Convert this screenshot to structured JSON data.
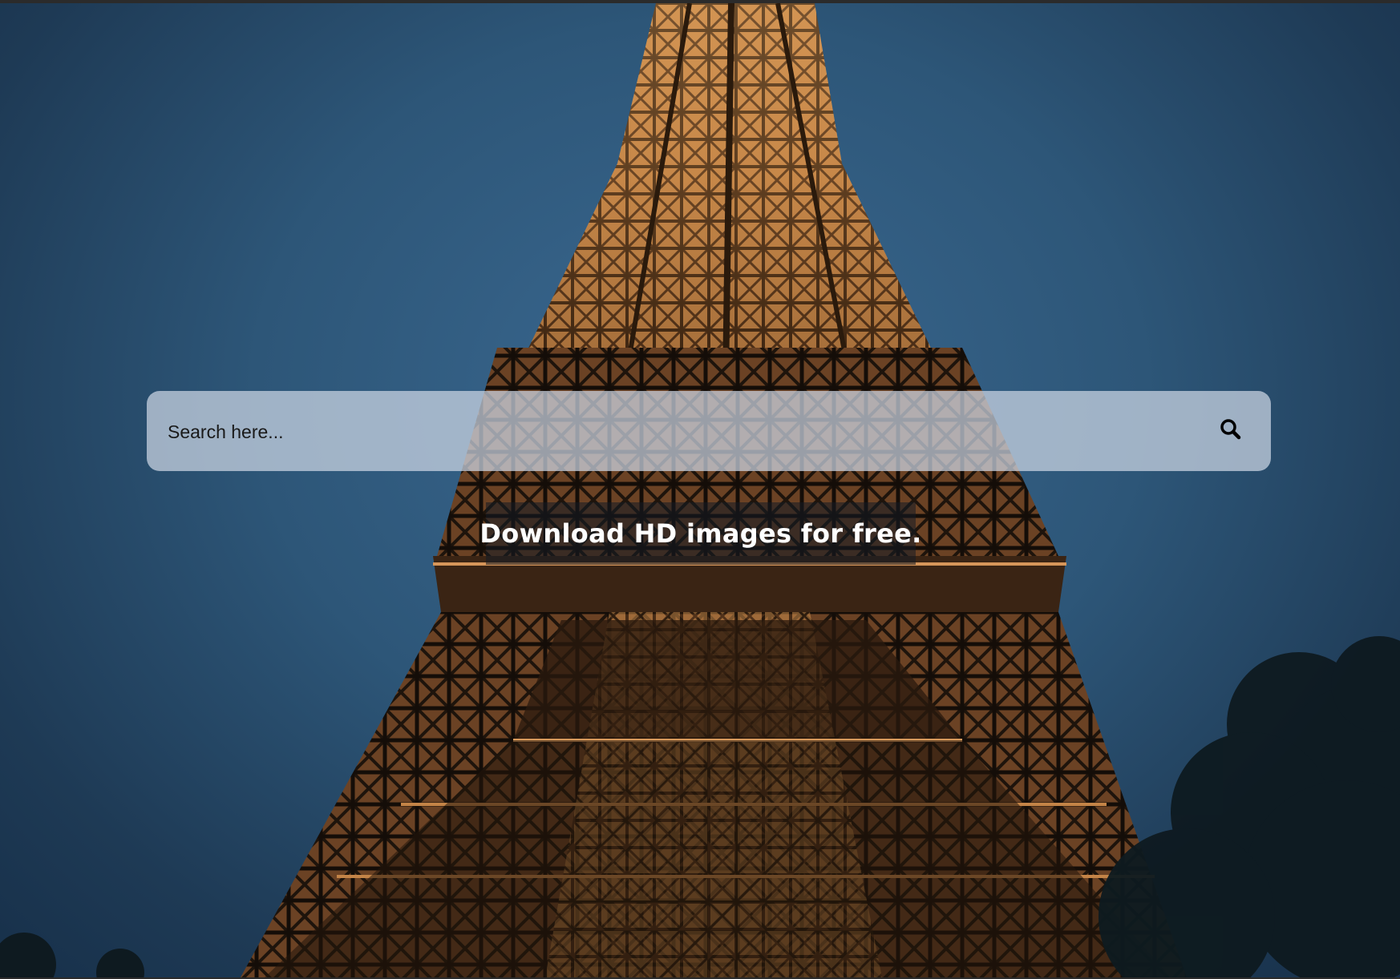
{
  "hero": {
    "background_icon": "eiffel-tower-night-photo",
    "sky_color": "#2f5a7e",
    "tower_light_color": "#e0a060"
  },
  "search": {
    "placeholder": "Search here...",
    "button_icon": "search-icon"
  },
  "tagline": {
    "text": "Download HD images for free."
  }
}
